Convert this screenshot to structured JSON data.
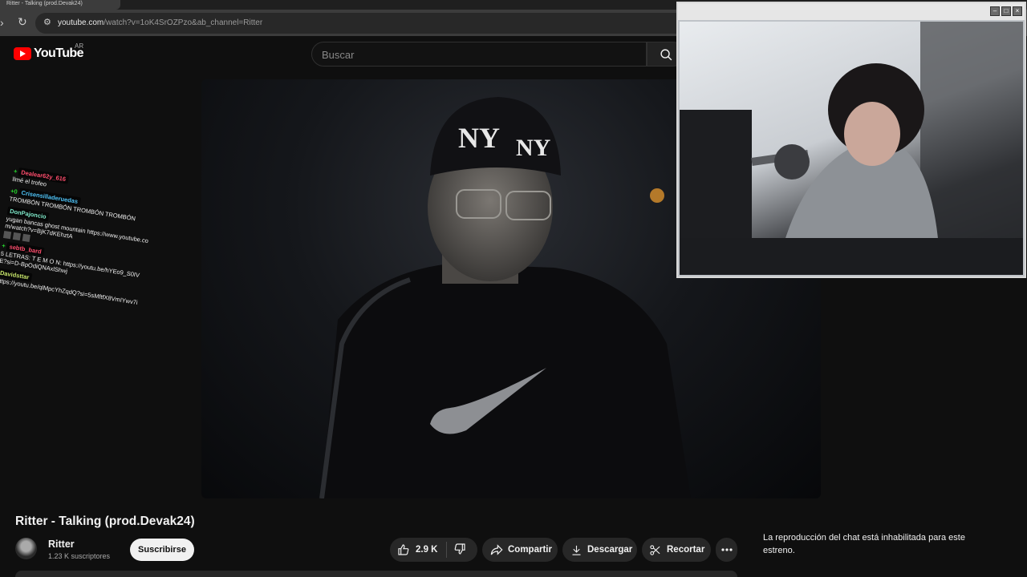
{
  "browser": {
    "tab_title": "Ritter - Talking (prod.Devak24)",
    "url_domain": "youtube.com",
    "url_path": "/watch?v=1oK4SrOZPzo&ab_channel=Ritter"
  },
  "header": {
    "logo_text": "YouTube",
    "country_code": "AR",
    "search_placeholder": "Buscar"
  },
  "chat_overlay": {
    "messages": [
      {
        "user": "Dealear62y_616",
        "user_color": "#ff4d6d",
        "badge": "+",
        "text": "llmé el trofeo"
      },
      {
        "user": "Crisensilladeruedas",
        "user_color": "#4fc3f7",
        "badge": "+0",
        "text": "TROMBÓN TROMBÓN TROMBÓN TROMBÓN"
      },
      {
        "user": "DonPajoncio",
        "user_color": "#7ee8c9",
        "badge": "",
        "text": "yugan bancas ghost mountain https://www.youtube.com/watch?v=BjK7dKEhztA"
      },
      {
        "user": "sebtb_bard",
        "user_color": "#ff4d6d",
        "badge": "+",
        "text": "5 LETRAS: T E M O N: https://youtu.be/hYEo9_S0IVE?si=D-BpOdiQNAxlShwj"
      },
      {
        "user": "Davidsttar",
        "user_color": "#c8e66b",
        "badge": "",
        "text": "https://youtu.be/qlMpcYhZqdQ?si=5sMftfX8VmIYwv7i"
      }
    ]
  },
  "video": {
    "title": "Ritter - Talking (prod.Devak24)"
  },
  "channel": {
    "name": "Ritter",
    "subscribers": "1.23 K suscriptores",
    "subscribe_label": "Suscribirse"
  },
  "actions": {
    "likes": "2.9 K",
    "share_label": "Compartir",
    "download_label": "Descargar",
    "clip_label": "Recortar"
  },
  "chat_panel": {
    "disabled_message": "La reproducción del chat está inhabilitada para este estreno."
  },
  "colors": {
    "background": "#0f0f0f",
    "youtube_red": "#ff0000",
    "pill_bg": "#272727"
  }
}
